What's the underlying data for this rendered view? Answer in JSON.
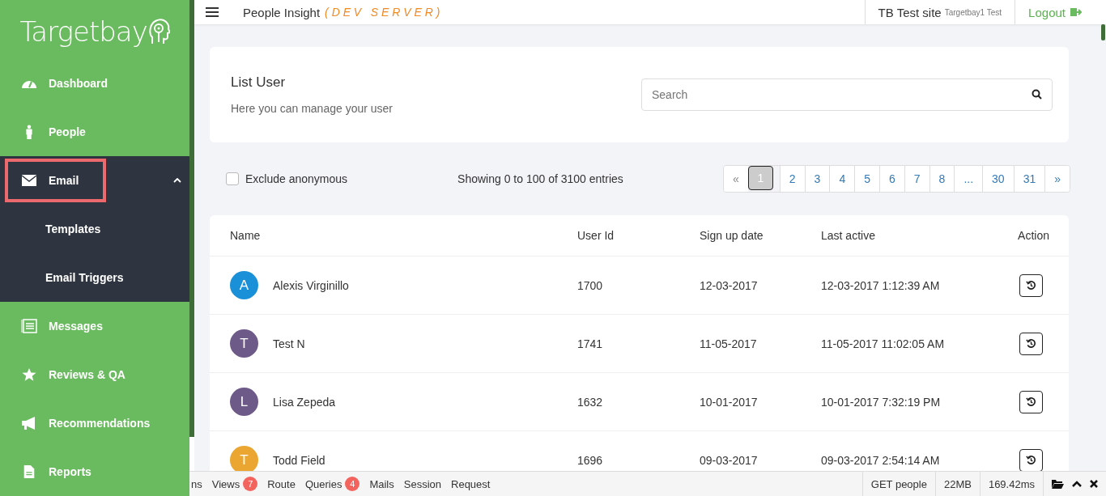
{
  "sidebar": {
    "logo": "Targetbay",
    "items": [
      {
        "label": "Dashboard",
        "highlighted": false
      },
      {
        "label": "People",
        "highlighted": false
      },
      {
        "label": "Email",
        "highlighted": true,
        "expanded": true,
        "children": [
          {
            "label": "Templates"
          },
          {
            "label": "Email Triggers"
          }
        ]
      },
      {
        "label": "Messages",
        "highlighted": false
      },
      {
        "label": "Reviews & QA",
        "highlighted": false
      },
      {
        "label": "Recommendations",
        "highlighted": false
      },
      {
        "label": "Reports",
        "highlighted": false
      }
    ]
  },
  "header": {
    "title": "People Insight",
    "server_tag": "( D E V   S E R V E R )",
    "site": "TB Test site",
    "site_sub": "Targetbay1 Test",
    "logout": "Logout"
  },
  "panel": {
    "title": "List User",
    "subtitle": "Here you can manage your user",
    "search": {
      "placeholder": "Search"
    }
  },
  "filters": {
    "exclude_anonymous": {
      "label": "Exclude anonymous",
      "checked": false
    },
    "summary": "Showing 0 to 100 of 3100 entries"
  },
  "pagination": [
    {
      "label": "«",
      "selected": false
    },
    {
      "label": "1",
      "selected": true
    },
    {
      "label": "2",
      "selected": false
    },
    {
      "label": "3",
      "selected": false
    },
    {
      "label": "4",
      "selected": false
    },
    {
      "label": "5",
      "selected": false
    },
    {
      "label": "6",
      "selected": false
    },
    {
      "label": "7",
      "selected": false
    },
    {
      "label": "8",
      "selected": false
    },
    {
      "label": "...",
      "selected": false
    },
    {
      "label": "30",
      "selected": false
    },
    {
      "label": "31",
      "selected": false
    },
    {
      "label": "»",
      "selected": false
    }
  ],
  "table": {
    "columns": [
      "Name",
      "User Id",
      "Sign up date",
      "Last active",
      "Action"
    ],
    "rows": [
      {
        "initial": "A",
        "color": "#1a90d9",
        "name": "Alexis Virginillo",
        "user_id": "1700",
        "signup": "12-03-2017",
        "last_active": "12-03-2017 1:12:39 AM"
      },
      {
        "initial": "T",
        "color": "#6e5a88",
        "name": "Test N",
        "user_id": "1741",
        "signup": "11-05-2017",
        "last_active": "11-05-2017 11:02:05 AM"
      },
      {
        "initial": "L",
        "color": "#6e5a88",
        "name": "Lisa Zepeda",
        "user_id": "1632",
        "signup": "10-01-2017",
        "last_active": "10-01-2017 7:32:19 PM"
      },
      {
        "initial": "T",
        "color": "#eaa630",
        "name": "Todd Field",
        "user_id": "1696",
        "signup": "09-03-2017",
        "last_active": "09-03-2017 2:54:14 AM"
      }
    ]
  },
  "debug_bar": {
    "tabs": [
      {
        "label": "ns"
      },
      {
        "label": "Views",
        "badge": "7"
      },
      {
        "label": "Route"
      },
      {
        "label": "Queries",
        "badge": "4"
      },
      {
        "label": "Mails"
      },
      {
        "label": "Session"
      },
      {
        "label": "Request"
      }
    ],
    "stats": [
      "GET people",
      "22MB",
      "169.42ms"
    ]
  }
}
